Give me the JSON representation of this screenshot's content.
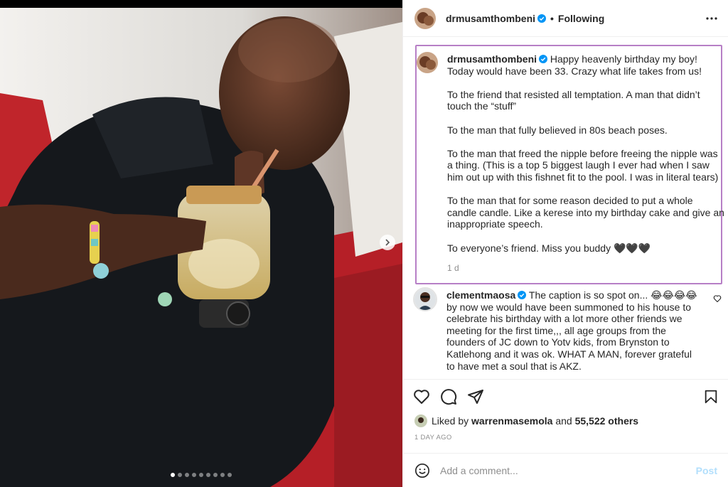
{
  "post": {
    "username": "drmusamthombeni",
    "follow_separator": "•",
    "follow_status": "Following",
    "caption_paragraphs": [
      "Happy heavenly birthday my boy! Today would have been 33. Crazy what life takes from us!",
      "To the friend that resisted all temptation. A man that didn’t touch the “stuff”",
      "To the man that fully believed in 80s beach poses.",
      "To the man that freed the nipple before freeing the nipple was a thing. (This is a top 5 biggest laugh I ever had when I saw him out up with this fishnet fit to the pool. I was in literal tears)",
      "To the man that for some reason decided to put a whole candle candle. Like a kerese into my birthday cake and give an inappropriate speech.",
      "To everyone’s friend. Miss you buddy 🖤🖤🖤"
    ],
    "caption_time": "1 d"
  },
  "comment": {
    "username": "clementmaosa",
    "text": "The caption is so spot on... 😂😂😂😂 by now we would have been summoned to his house to celebrate his birthday with a lot more other friends we meeting for the first time,,, all age groups from the founders of JC down to Yotv kids, from Brynston to Katlehong and it was ok. WHAT A MAN, forever grateful to have met a soul that is AKZ."
  },
  "likes": {
    "prefix": "Liked by",
    "user": "warrenmasemola",
    "and": "and",
    "others": "55,522 others"
  },
  "date": "1 DAY AGO",
  "add_comment": {
    "placeholder": "Add a comment...",
    "post_label": "Post"
  },
  "carousel": {
    "count": 9,
    "active_index": 0
  },
  "colors": {
    "verified": "#0095f6",
    "caption_highlight": "#b77fc6",
    "post_disabled": "#b2dffc"
  },
  "icons": [
    "verified-badge-icon",
    "more-options-icon",
    "heart-icon",
    "comment-icon",
    "share-icon",
    "bookmark-icon",
    "emoji-icon",
    "chevron-right-icon"
  ]
}
